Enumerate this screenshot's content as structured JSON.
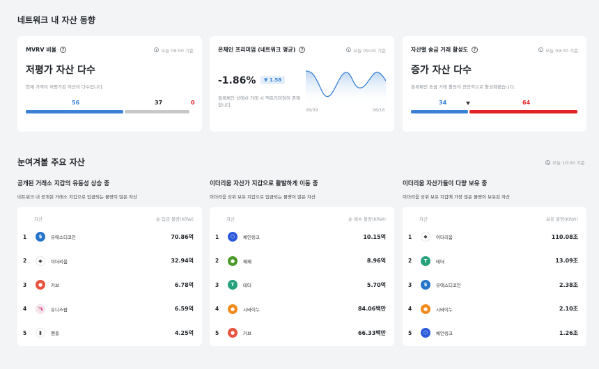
{
  "section1": {
    "title": "네트워크 내 자산 동향"
  },
  "mvrv": {
    "title": "MVRV 비율",
    "time": "오늘 09:00 기준",
    "headline": "저평가 자산 다수",
    "desc": "현재 가격이 저평가된 자산이 다수입니다.",
    "low": "56",
    "mid": "37",
    "high": "0",
    "colors": {
      "low": "#3b82d6",
      "mid": "#c8c8c8",
      "high": "#e02424"
    }
  },
  "premium": {
    "title": "온체인 프리미엄 (네트워크 평균)",
    "time": "오늘 09:00 기준",
    "value": "-1.86%",
    "change": "▼ 1.58",
    "desc": "블록체인 상에서 거래 시 액프리미엄이 존재합니다.",
    "date_start": "06/09",
    "date_end": "06/16"
  },
  "transfer": {
    "title": "자산별 송금 거래 활성도",
    "time": "오늘 09:00 기준",
    "headline": "증가 자산 다수",
    "desc": "블록체인 송금 거래 활동이 전반적으로 활성화됐습니다.",
    "low": "34",
    "high": "64",
    "colors": {
      "low": "#3b82d6",
      "high": "#e02424"
    }
  },
  "section2": {
    "title": "눈여겨볼 주요 자산",
    "time": "오늘 10:00 기준"
  },
  "tables": [
    {
      "title": "공개된 거래소 지갑의 유동성 상승 중",
      "desc": "네트워크 내 공개된 거래소 지갑으로 입금되는 물량이 많은 자산",
      "col_asset": "자산",
      "col_value": "순 입금 물량(KRW)",
      "rows": [
        {
          "rank": "1",
          "name": "유에스디코인",
          "value": "70.86억",
          "icon": "usdc-icon",
          "color": "#2775ca",
          "glyph": "$"
        },
        {
          "rank": "2",
          "name": "이더리움",
          "value": "32.94억",
          "icon": "ethereum-icon",
          "color": "#ffffff",
          "glyph": "◆"
        },
        {
          "rank": "3",
          "name": "커브",
          "value": "6.78억",
          "icon": "curve-icon",
          "color": "#e8533f",
          "glyph": "●"
        },
        {
          "rank": "4",
          "name": "유니스왑",
          "value": "6.59억",
          "icon": "uniswap-icon",
          "color": "#ffe4f1",
          "glyph": "🦄"
        },
        {
          "rank": "5",
          "name": "펜들",
          "value": "4.25억",
          "icon": "pendle-icon",
          "color": "#ffffff",
          "glyph": "▮"
        }
      ]
    },
    {
      "title": "이더리움 자산가 지갑으로 활발하게 이동 중",
      "desc": "이더리움 상위 보유 지갑으로 입금되는 물량이 많은 자산",
      "col_asset": "자산",
      "col_value": "순 매수 물량(KRW)",
      "rows": [
        {
          "rank": "1",
          "name": "체인링크",
          "value": "10.15억",
          "icon": "chainlink-icon",
          "color": "#2a5ada",
          "glyph": "⬡"
        },
        {
          "rank": "2",
          "name": "페페",
          "value": "8.96억",
          "icon": "pepe-icon",
          "color": "#4c9a2a",
          "glyph": "●"
        },
        {
          "rank": "3",
          "name": "테더",
          "value": "5.70억",
          "icon": "tether-icon",
          "color": "#26a17b",
          "glyph": "T"
        },
        {
          "rank": "4",
          "name": "시바이누",
          "value": "84.06백만",
          "icon": "shiba-icon",
          "color": "#f28a1e",
          "glyph": "●"
        },
        {
          "rank": "5",
          "name": "커브",
          "value": "66.33백만",
          "icon": "curve-icon",
          "color": "#e8533f",
          "glyph": "●"
        }
      ]
    },
    {
      "title": "이더리움 자산가들이 다량 보유 중",
      "desc": "이더리움 상위 보유 지갑에 가장 많은 물량이 보유된 자산",
      "col_asset": "자산",
      "col_value": "보유 물량(KRW)",
      "rows": [
        {
          "rank": "1",
          "name": "이더리움",
          "value": "110.08조",
          "icon": "ethereum-icon",
          "color": "#ffffff",
          "glyph": "◆"
        },
        {
          "rank": "2",
          "name": "테더",
          "value": "13.09조",
          "icon": "tether-icon",
          "color": "#26a17b",
          "glyph": "T"
        },
        {
          "rank": "3",
          "name": "유에스디코인",
          "value": "2.38조",
          "icon": "usdc-icon",
          "color": "#2775ca",
          "glyph": "$"
        },
        {
          "rank": "4",
          "name": "시바이누",
          "value": "2.10조",
          "icon": "shiba-icon",
          "color": "#f28a1e",
          "glyph": "●"
        },
        {
          "rank": "5",
          "name": "체인링크",
          "value": "1.26조",
          "icon": "chainlink-icon",
          "color": "#2a5ada",
          "glyph": "⬡"
        }
      ]
    }
  ]
}
